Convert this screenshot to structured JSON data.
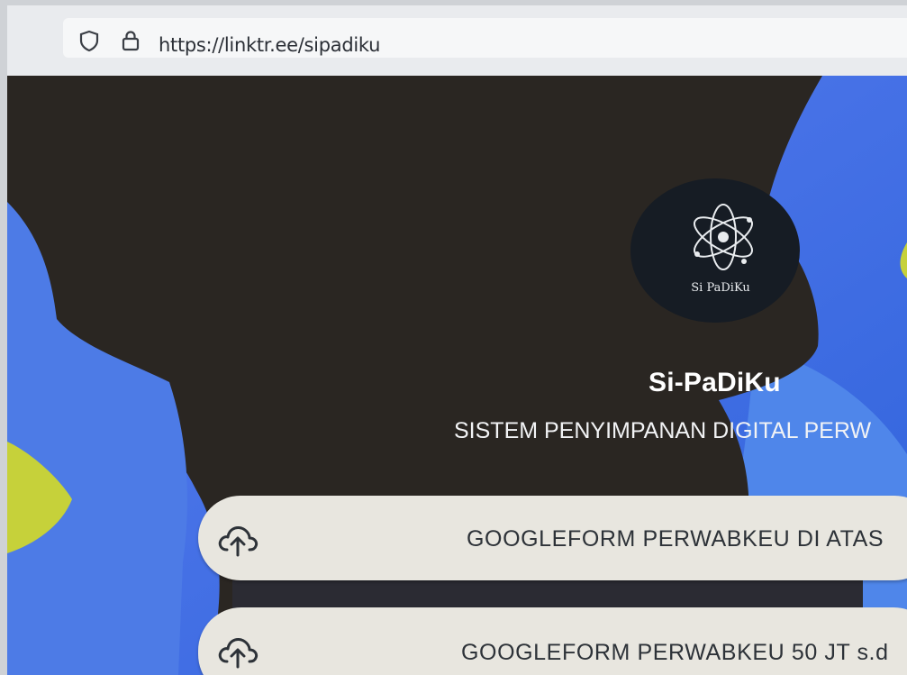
{
  "browser": {
    "url": "https://linktr.ee/sipadiku",
    "security_icons": [
      "shield-icon",
      "lock-icon"
    ]
  },
  "profile": {
    "logo_text": "Si PaDiKu",
    "title": "Si-PaDiKu",
    "subtitle": "SISTEM PENYIMPANAN DIGITAL PERW"
  },
  "links": [
    {
      "icon": "cloud-upload-icon",
      "label": "GOOGLEFORM PERWABKEU DI ATAS"
    },
    {
      "icon": "cloud-upload-icon",
      "label": "GOOGLEFORM PERWABKEU 50 JT s.d"
    }
  ],
  "colors": {
    "background_blue": "#3d6fe0",
    "accent_yellow": "#c6d13a",
    "button_bg": "#e8e6df"
  }
}
